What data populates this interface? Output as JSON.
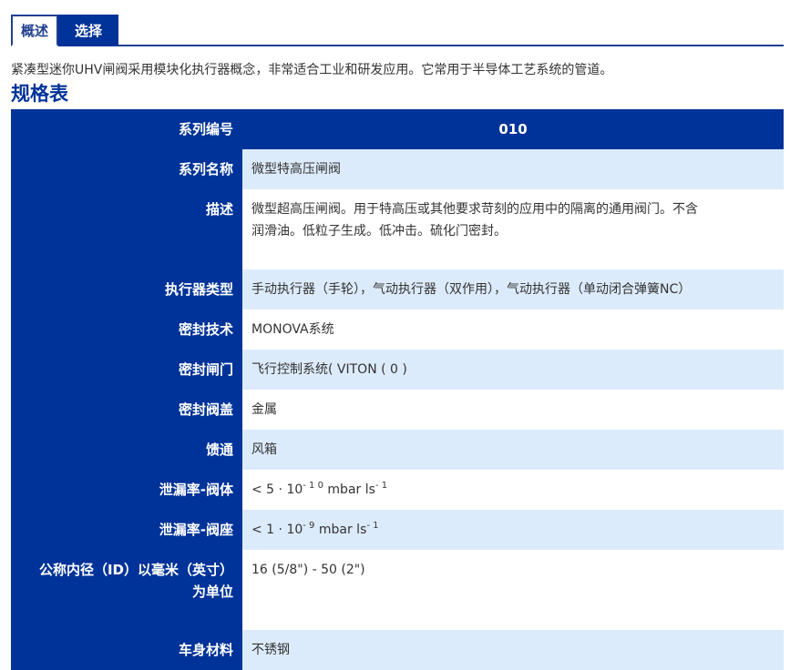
{
  "tabs": {
    "overview": "概述",
    "select": "选择"
  },
  "intro_text": "紧凑型迷你UHV闸阀采用模块化执行器概念，非常适合工业和研发应用。它常用于半导体工艺系统的管道。",
  "spec_title": "规格表",
  "spec_table": {
    "header": {
      "label": "系列编号",
      "value": "010"
    },
    "rows": [
      {
        "label": "系列名称",
        "value": "微型特高压闸阀"
      },
      {
        "label": "描述",
        "value_line1": "微型超高压闸阀。用于特高压或其他要求苛刻的应用中的隔离的通用阀门。不含",
        "value_line2": "润滑油。低粒子生成。低冲击。硫化门密封。"
      },
      {
        "label": "执行器类型",
        "value": "手动执行器（手轮），气动执行器（双作用），气动执行器（单动闭合弹簧NC）"
      },
      {
        "label": "密封技术",
        "value": "MONOVA系统"
      },
      {
        "label": "密封闸门",
        "value": "飞行控制系统( VITON ( 0 )"
      },
      {
        "label": "密封阀盖",
        "value": "金属"
      },
      {
        "label": "馈通",
        "value": "风箱"
      },
      {
        "label": "泄漏率-阀体",
        "value_prefix": "< 5 · 10",
        "value_exp": "- 1 0",
        "value_unit": "mbar ls",
        "value_unit_exp": "- 1"
      },
      {
        "label": "泄漏率-阀座",
        "value_prefix": "< 1 · 10",
        "value_exp": "- 9",
        "value_unit": "mbar ls",
        "value_unit_exp": "- 1"
      },
      {
        "label_line1": "公称内径（ID）以毫米（英寸）",
        "label_line2": "为单位",
        "value": "16 (5/8\") - 50 (2\")"
      },
      {
        "label": "车身材料",
        "value": "不锈钢"
      }
    ]
  }
}
